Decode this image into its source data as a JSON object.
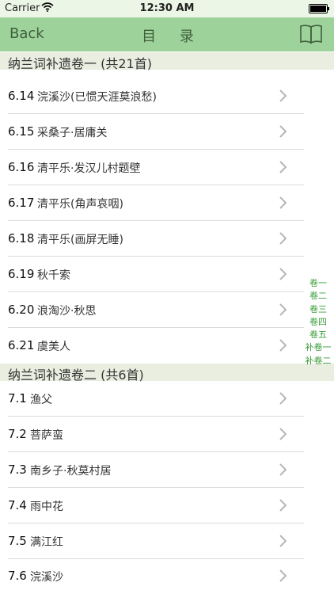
{
  "status_bar": {
    "carrier": "Carrier",
    "time": "12:30 AM"
  },
  "nav": {
    "back_label": "Back",
    "title": "目 录"
  },
  "sections": [
    {
      "title": "纳兰词补遗卷一 (共21首)"
    },
    {
      "title": "纳兰词补遗卷二 (共6首)"
    }
  ],
  "rows": [
    {
      "num": "6.14",
      "title": "浣溪沙(已惯天涯莫浪愁)"
    },
    {
      "num": "6.15",
      "title": "采桑子·居庸关"
    },
    {
      "num": "6.16",
      "title": "清平乐·发汉儿村题壁"
    },
    {
      "num": "6.17",
      "title": "清平乐(角声哀咽)"
    },
    {
      "num": "6.18",
      "title": "清平乐(画屏无睡)"
    },
    {
      "num": "6.19",
      "title": "秋千索"
    },
    {
      "num": "6.20",
      "title": "浪淘沙·秋思"
    },
    {
      "num": "6.21",
      "title": "虞美人"
    },
    {
      "num": "7.1",
      "title": "渔父"
    },
    {
      "num": "7.2",
      "title": "菩萨蛮"
    },
    {
      "num": "7.3",
      "title": "南乡子·秋莫村居"
    },
    {
      "num": "7.4",
      "title": "雨中花"
    },
    {
      "num": "7.5",
      "title": "满江红"
    },
    {
      "num": "7.6",
      "title": "浣溪沙"
    }
  ],
  "index": [
    "卷一",
    "卷二",
    "卷三",
    "卷四",
    "卷五",
    "补卷一",
    "补卷二"
  ],
  "colors": {
    "navbar": "#9ed29b",
    "nav_text": "#3f5f3b",
    "index_text": "#3a9c3a"
  }
}
